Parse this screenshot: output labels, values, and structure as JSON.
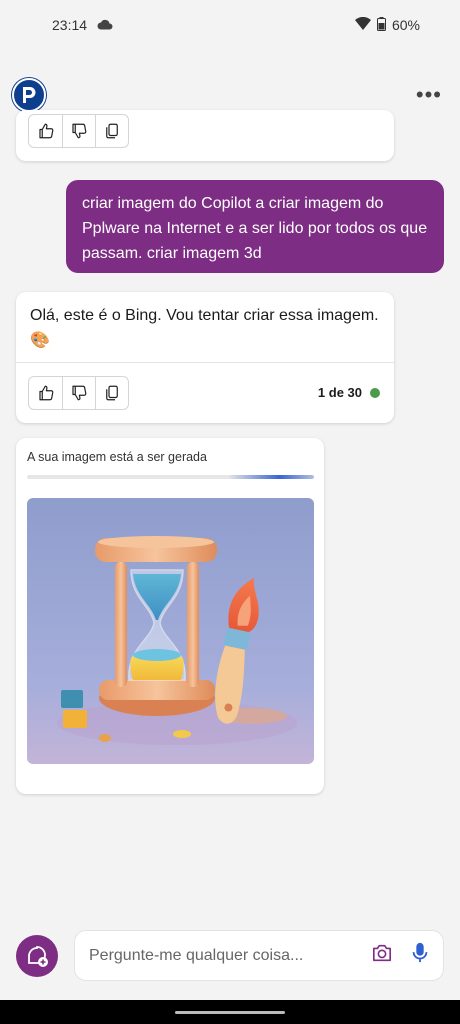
{
  "status_bar": {
    "time": "23:14",
    "battery": "60%"
  },
  "header": {
    "more_label": "•••"
  },
  "messages": {
    "user_prompt": "criar imagem do Copilot a criar imagem do Pplware na Internet e a ser lido por todos os que passam. criar imagem 3d",
    "bot_reply": "Olá, este é o Bing. Vou tentar criar essa imagem. 🎨",
    "counter": "1 de 30",
    "counter_dot_color": "#4a9a4a"
  },
  "image_card": {
    "status_text": "A sua imagem está a ser gerada",
    "progress_fraction": 0.3
  },
  "composer": {
    "placeholder": "Pergunte-me qualquer coisa..."
  },
  "colors": {
    "accent": "#7d2d83",
    "user_bubble": "#7d2d83",
    "logo": "#0e3f8f",
    "mic": "#2f5fd0"
  }
}
